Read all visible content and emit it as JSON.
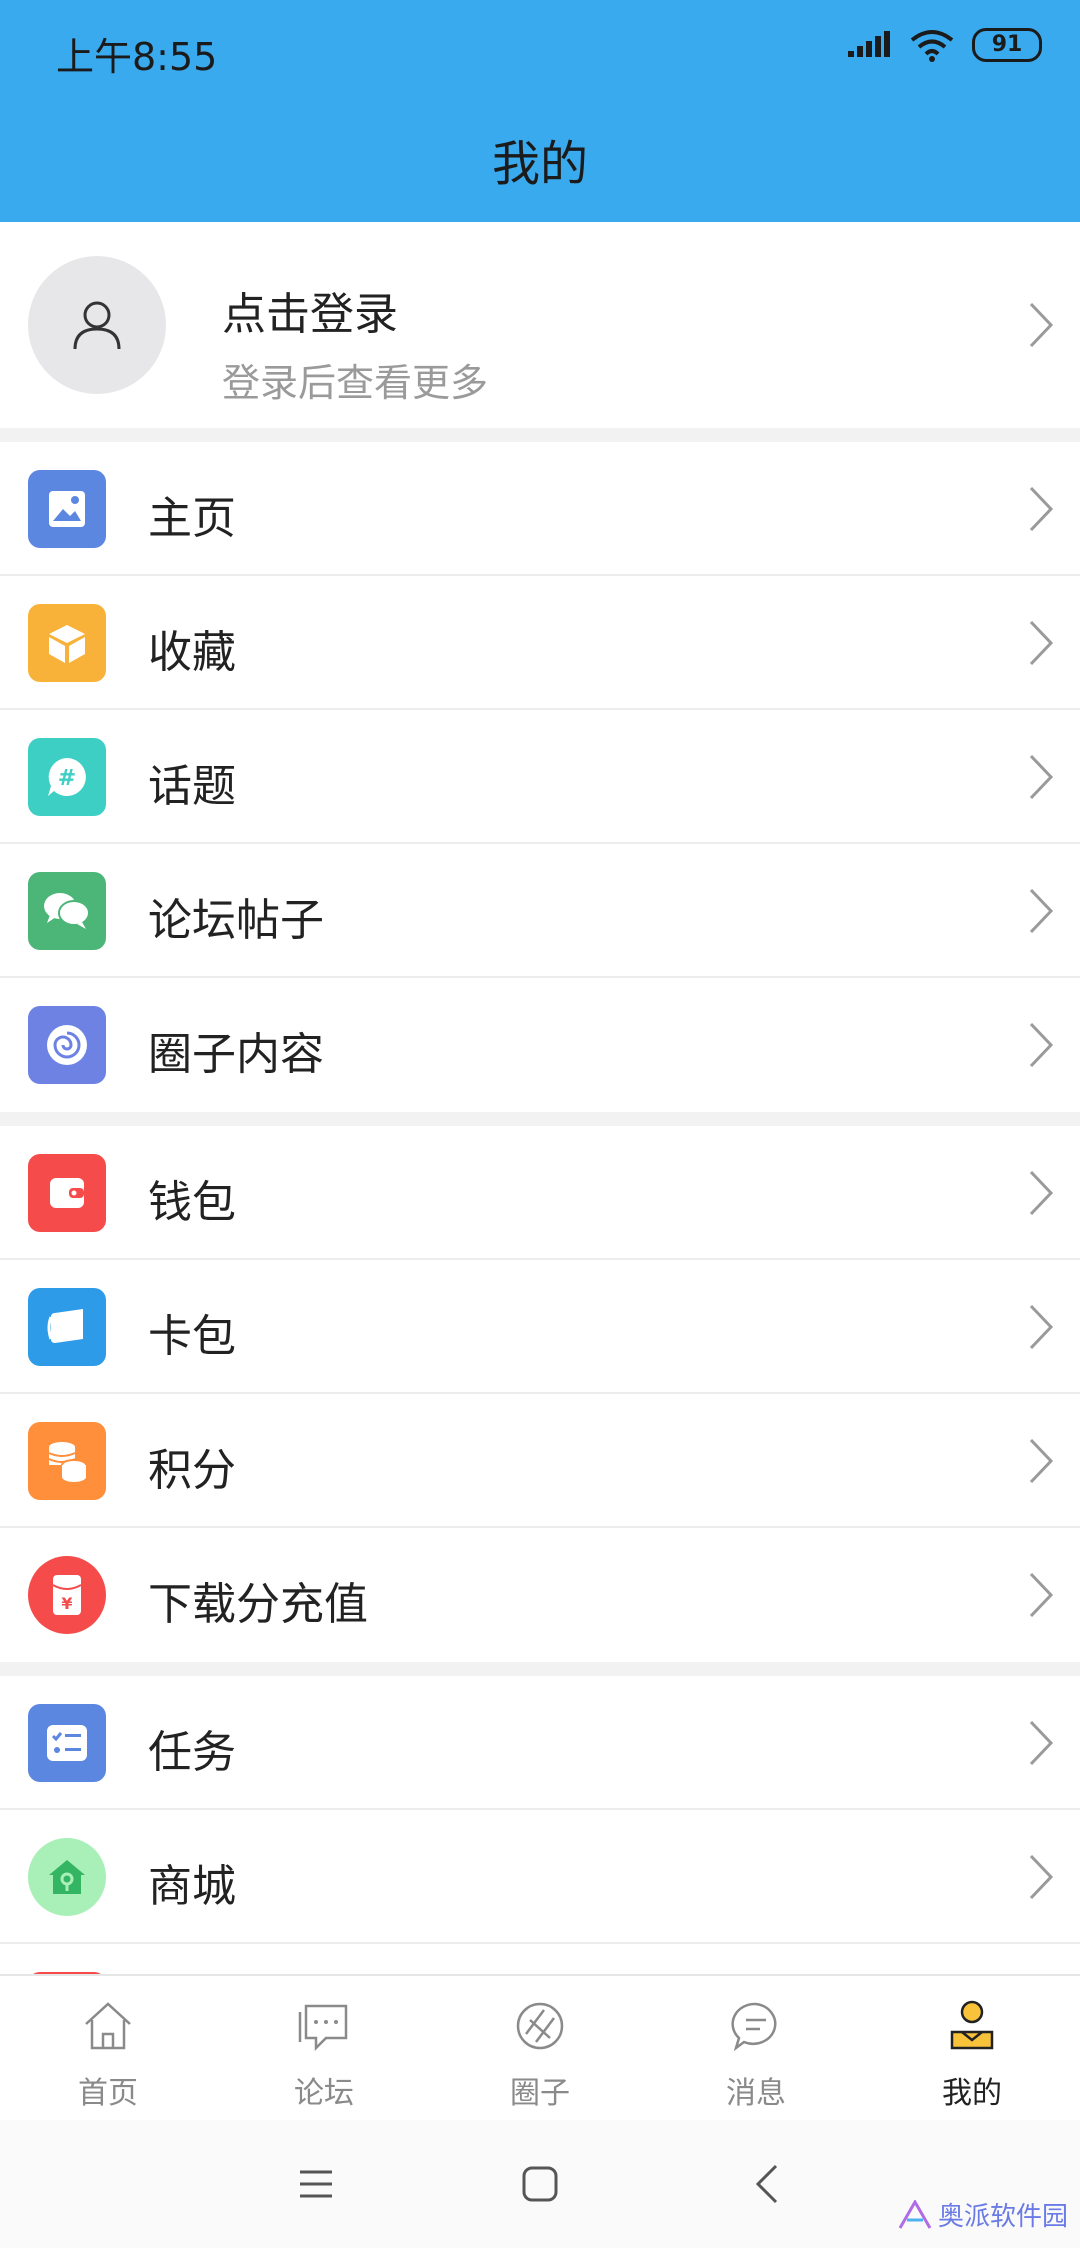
{
  "status_bar": {
    "time": "上午8:55",
    "battery": "91"
  },
  "header": {
    "title": "我的"
  },
  "profile": {
    "title": "点击登录",
    "subtitle": "登录后查看更多"
  },
  "menu": [
    {
      "label": "主页",
      "icon": "picture-icon",
      "color": "#5b87e0"
    },
    {
      "label": "收藏",
      "icon": "box-icon",
      "color": "#f8b23a"
    },
    {
      "label": "话题",
      "icon": "hashtag-bubble-icon",
      "color": "#3ecfc4"
    },
    {
      "label": "论坛帖子",
      "icon": "chat-bubbles-icon",
      "color": "#4cb578"
    },
    {
      "label": "圈子内容",
      "icon": "swirl-icon",
      "color": "#6e82e4"
    },
    {
      "label": "钱包",
      "icon": "wallet-icon",
      "color": "#f54b4b"
    },
    {
      "label": "卡包",
      "icon": "card-icon",
      "color": "#2e9be8"
    },
    {
      "label": "积分",
      "icon": "coins-icon",
      "color": "#ff8f3a"
    },
    {
      "label": "下载分充值",
      "icon": "red-envelope-icon",
      "color": "#f54b4b"
    },
    {
      "label": "任务",
      "icon": "checklist-icon",
      "color": "#5b87e0"
    },
    {
      "label": "商城",
      "icon": "shop-icon",
      "color": "#a8f0b8"
    }
  ],
  "tabs": [
    {
      "label": "首页",
      "icon": "home-icon"
    },
    {
      "label": "论坛",
      "icon": "forum-icon"
    },
    {
      "label": "圈子",
      "icon": "circle-icon"
    },
    {
      "label": "消息",
      "icon": "message-icon"
    },
    {
      "label": "我的",
      "icon": "profile-icon",
      "active": true
    }
  ],
  "watermark": "奥派软件园"
}
